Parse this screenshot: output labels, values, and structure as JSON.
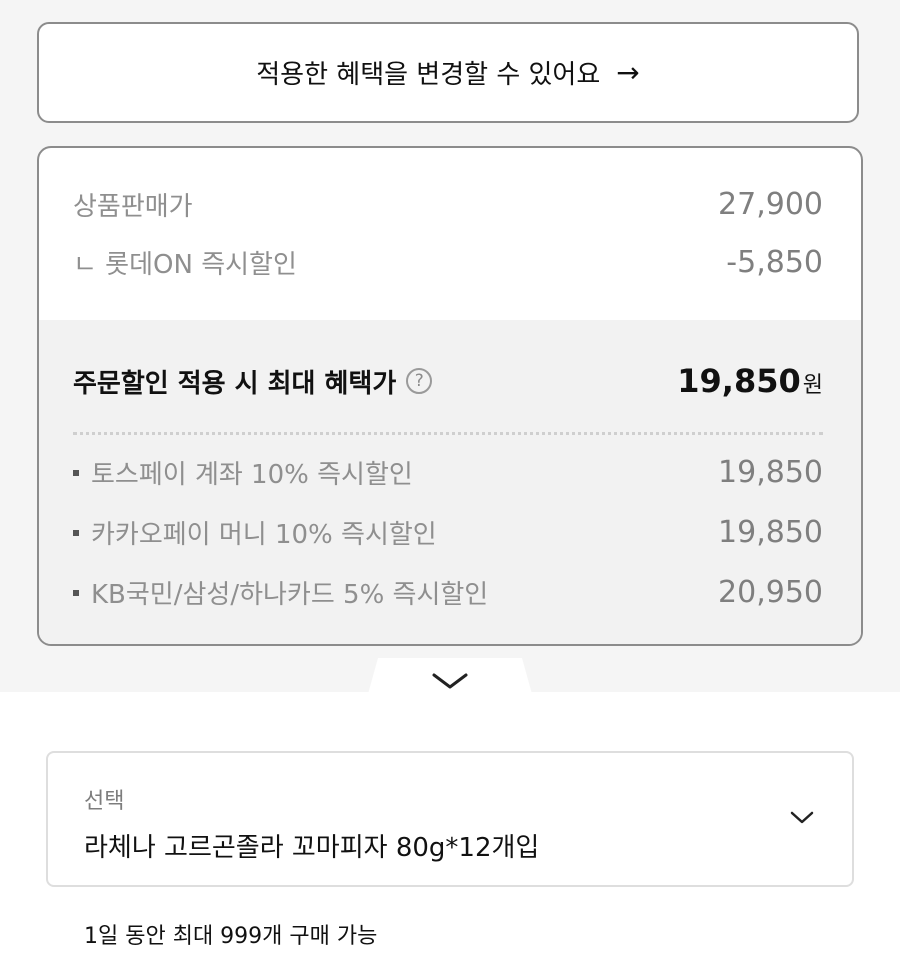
{
  "change_benefit": {
    "label": "적용한 혜택을 변경할 수 있어요",
    "arrow": "→"
  },
  "pricing": {
    "sale_price_label": "상품판매가",
    "sale_price_value": "27,900",
    "instant_discount_label": "ㄴ 롯데ON 즉시할인",
    "instant_discount_value": "-5,850",
    "best_price_label": "주문할인 적용 시 최대 혜택가",
    "best_price_value": "19,850",
    "best_price_unit": "원",
    "help_icon": "?",
    "discounts": [
      {
        "label": "토스페이 계좌 10% 즉시할인",
        "value": "19,850"
      },
      {
        "label": "카카오페이 머니 10% 즉시할인",
        "value": "19,850"
      },
      {
        "label": "KB국민/삼성/하나카드 5% 즉시할인",
        "value": "20,950"
      }
    ]
  },
  "option": {
    "label": "선택",
    "value": "라체나 고르곤졸라 꼬마피자 80g*12개입"
  },
  "purchase_limit": "1일 동안 최대 999개 구매 가능",
  "icons": {
    "arrow": "arrow-right-icon",
    "help": "question-circle-icon",
    "expand": "chevron-down-icon"
  }
}
